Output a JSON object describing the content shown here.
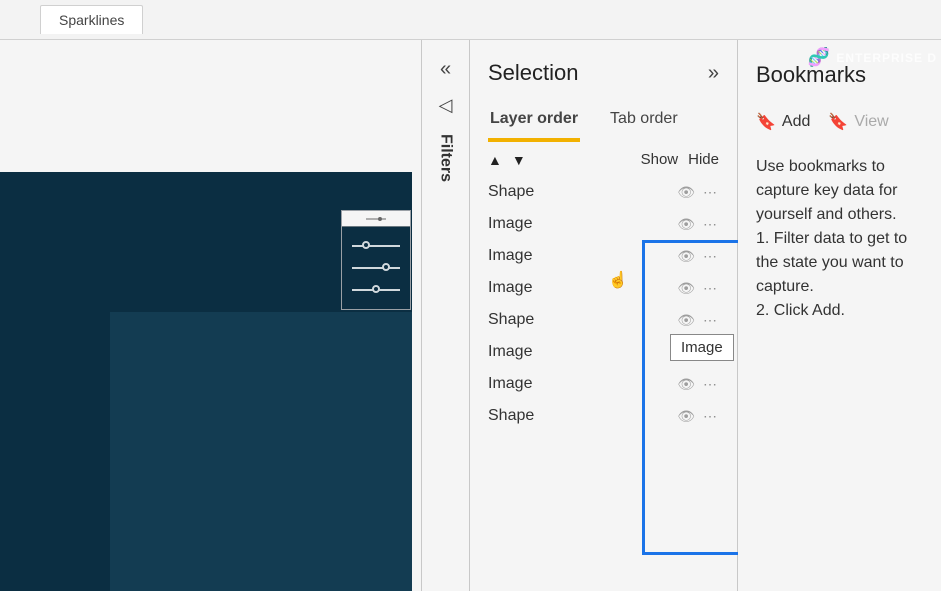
{
  "topbar": {
    "tab_label": "Sparklines"
  },
  "filters_pane": {
    "label": "Filters"
  },
  "selection": {
    "title": "Selection",
    "tabs": {
      "layer_order": "Layer order",
      "tab_order": "Tab order"
    },
    "show_label": "Show",
    "hide_label": "Hide",
    "tooltip": "Image",
    "items": [
      {
        "name": "Shape"
      },
      {
        "name": "Image"
      },
      {
        "name": "Image"
      },
      {
        "name": "Image"
      },
      {
        "name": "Shape"
      },
      {
        "name": "Image"
      },
      {
        "name": "Image"
      },
      {
        "name": "Shape"
      }
    ]
  },
  "bookmarks": {
    "title": "Bookmarks",
    "add_label": "Add",
    "view_label": "View",
    "instructions": "Use bookmarks to capture key data for yourself and others.\n1. Filter data to get to the state you want to capture.\n2. Click Add."
  },
  "watermark": {
    "text": "ENTERPRISE D"
  }
}
